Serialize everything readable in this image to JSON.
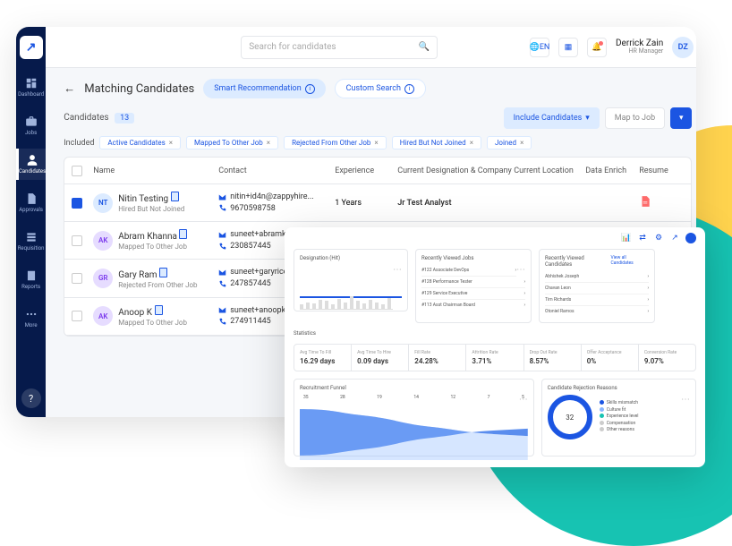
{
  "topbar": {
    "search_placeholder": "Search for candidates",
    "lang": "EN",
    "user_name": "Derrick Zain",
    "user_role": "HR Manager",
    "user_initials": "DZ"
  },
  "sidebar": {
    "items": [
      {
        "label": "Dashboard"
      },
      {
        "label": "Jobs"
      },
      {
        "label": "Candidates"
      },
      {
        "label": "Approvals"
      },
      {
        "label": "Requisition"
      },
      {
        "label": "Reports"
      },
      {
        "label": "More"
      }
    ]
  },
  "page": {
    "title": "Matching Candidates",
    "tabs": {
      "smart": "Smart Recommendation",
      "custom": "Custom Search"
    },
    "candidates_label": "Candidates",
    "count": "13",
    "include_btn": "Include Candidates",
    "map_btn": "Map to Job",
    "included_label": "Included",
    "filters": [
      "Active Candidates",
      "Mapped To Other Job",
      "Rejected From Other Job",
      "Hired But Not Joined",
      "Joined"
    ]
  },
  "table": {
    "headers": {
      "name": "Name",
      "contact": "Contact",
      "experience": "Experience",
      "designation": "Current Designation & Company",
      "location": "Current Location",
      "data_enrich": "Data Enrich",
      "resume": "Resume"
    },
    "rows": [
      {
        "checked": true,
        "initials": "NT",
        "av": "blue",
        "name": "Nitin Testing",
        "status": "Hired But Not Joined",
        "email": "nitin+id4n@zappyhire...",
        "phone": "9670598758",
        "experience": "1 Years",
        "designation": "Jr Test Analyst",
        "resume": true
      },
      {
        "checked": false,
        "initials": "AK",
        "av": "purple",
        "name": "Abram Khanna",
        "status": "Mapped To Other Job",
        "email": "suneet+abramk@...",
        "phone": "230857445",
        "blackbox": true
      },
      {
        "checked": false,
        "initials": "GR",
        "av": "purple",
        "name": "Gary Ram",
        "status": "Rejected From Other Job",
        "email": "suneet+garyrice@...",
        "phone": "247857445"
      },
      {
        "checked": false,
        "initials": "AK",
        "av": "purple",
        "name": "Anoop K",
        "status": "Mapped To Other Job",
        "email": "suneet+anoopk@...",
        "phone": "274911445"
      }
    ]
  },
  "overlay": {
    "card1_title": "Designation (Hit)",
    "card2": {
      "title": "Recently Viewed Jobs",
      "items": [
        "#122 Associate DevOps",
        "#128 Performance Tester",
        "#129 Service Executive",
        "#113 Asst Chairman Board"
      ]
    },
    "card3": {
      "title": "Recently Viewed Candidates",
      "items": [
        "Abhishek Joseph",
        "Chavan Leon",
        "Tim Richards",
        "Otoniel Ramos"
      ],
      "view_all": "View all Candidates"
    },
    "stats_title": "Statistics",
    "stats": [
      {
        "l": "Avg Time To Fill",
        "v": "16.29 days"
      },
      {
        "l": "Avg Time To Hire",
        "v": "0.09 days"
      },
      {
        "l": "Fill Rate",
        "v": "24.28%"
      },
      {
        "l": "Attrition Rate",
        "v": "3.71%"
      },
      {
        "l": "Drop Out Rate",
        "v": "8.57%"
      },
      {
        "l": "Offer Acceptance",
        "v": "0%"
      },
      {
        "l": "Conversion Rate",
        "v": "9.07%"
      }
    ],
    "funnel_title": "Recruitment Funnel",
    "funnel_labels": [
      "35",
      "28",
      "19",
      "14",
      "12",
      "7",
      "5"
    ],
    "donut_title": "Candidate Rejection Reasons",
    "donut_value": "32",
    "legend": [
      "Skills mismatch",
      "Culture fit",
      "Experience level",
      "Compensation",
      "Other reasons"
    ]
  }
}
